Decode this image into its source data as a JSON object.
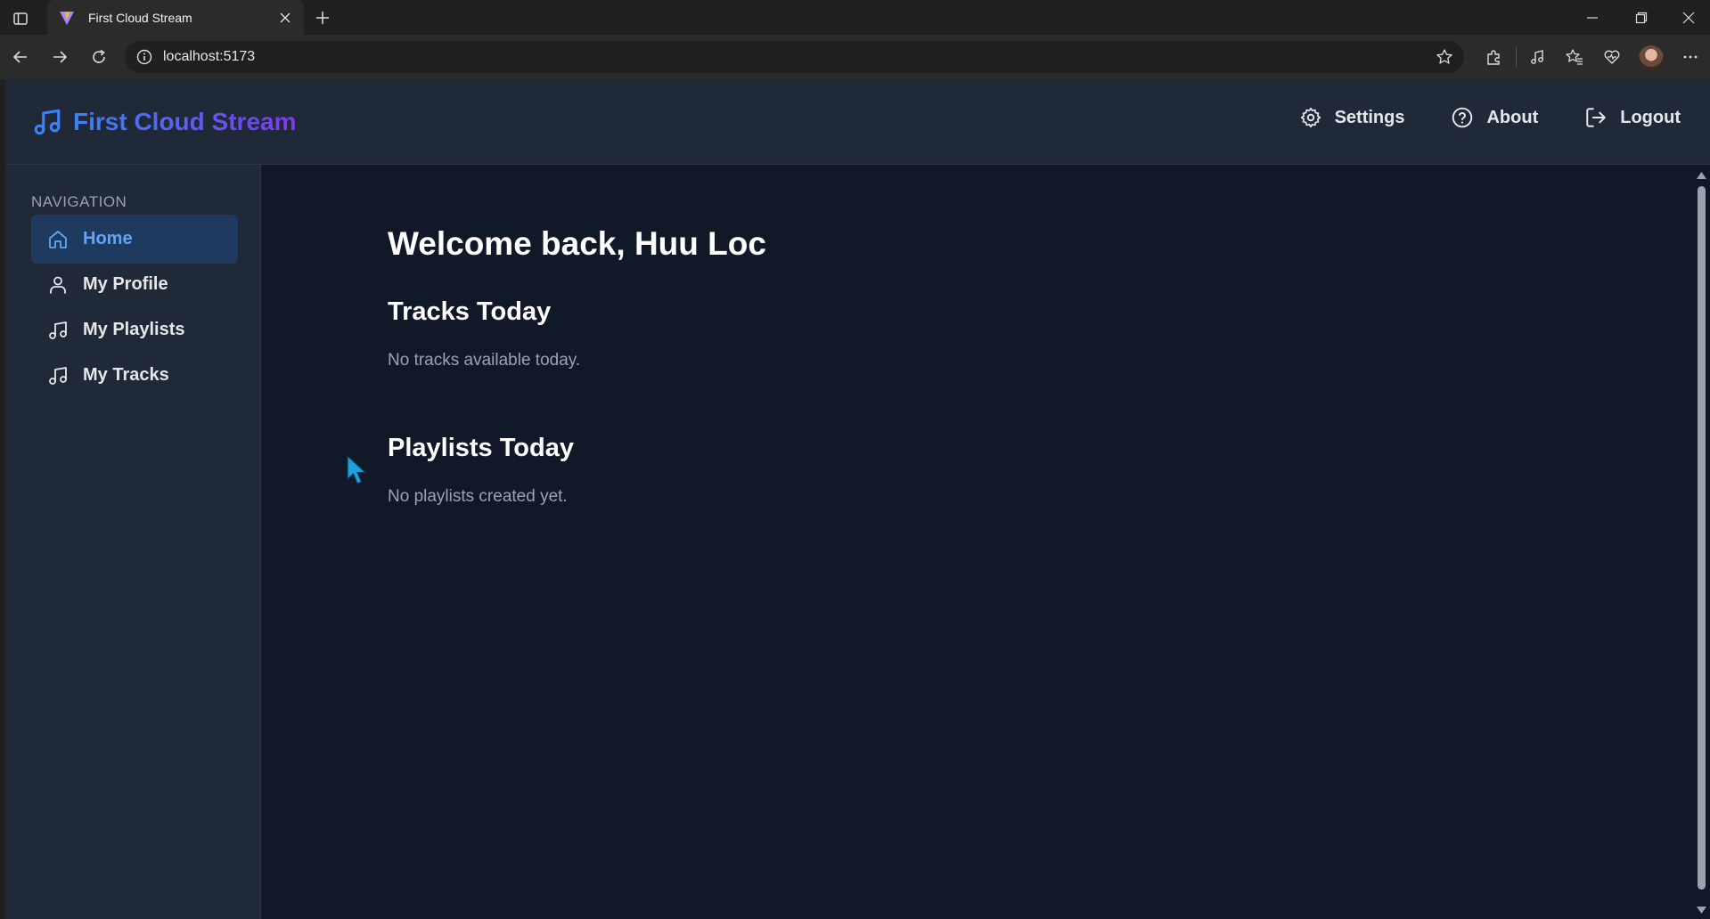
{
  "browser": {
    "tab_title": "First Cloud Stream",
    "url": "localhost:5173"
  },
  "header": {
    "brand": "First Cloud Stream",
    "links": {
      "settings": "Settings",
      "about": "About",
      "logout": "Logout"
    }
  },
  "sidebar": {
    "heading": "NAVIGATION",
    "items": [
      {
        "label": "Home",
        "icon": "home-icon",
        "active": true
      },
      {
        "label": "My Profile",
        "icon": "user-icon",
        "active": false
      },
      {
        "label": "My Playlists",
        "icon": "music-note-icon",
        "active": false
      },
      {
        "label": "My Tracks",
        "icon": "music-note-icon",
        "active": false
      }
    ]
  },
  "main": {
    "welcome": "Welcome back, Huu Loc",
    "tracks_title": "Tracks Today",
    "tracks_empty": "No tracks available today.",
    "playlists_title": "Playlists Today",
    "playlists_empty": "No playlists created yet."
  },
  "colors": {
    "page_bg": "#111827",
    "panel_bg": "#1f2937",
    "accent": "#60a5fa",
    "brand_gradient_start": "#3b82f6",
    "brand_gradient_end": "#7c3aed"
  }
}
